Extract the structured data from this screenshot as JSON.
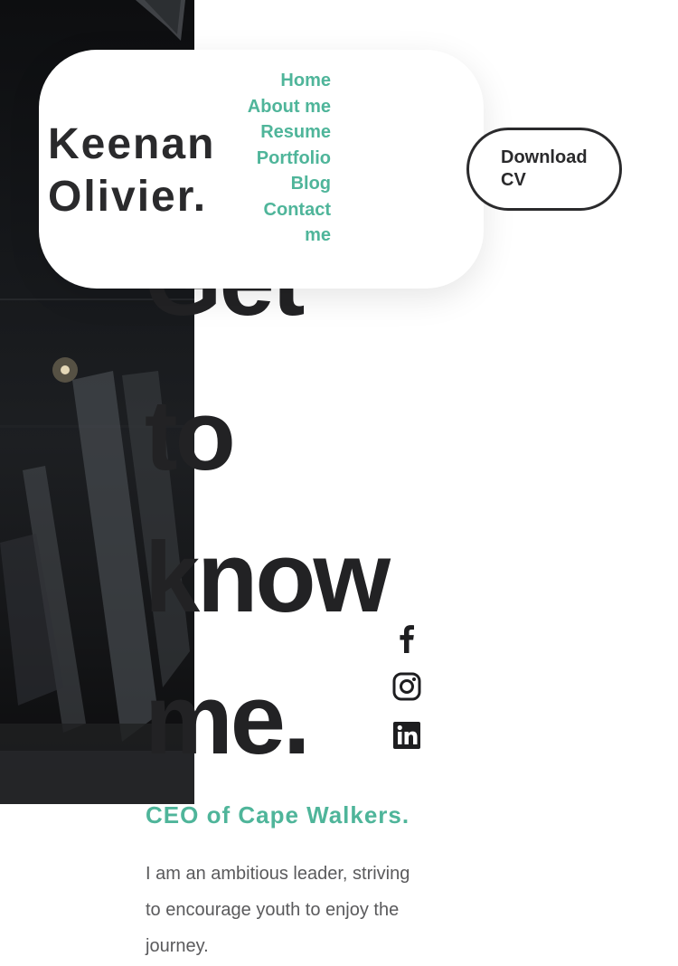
{
  "brand": {
    "line1": "Keenan",
    "line2": "Olivier."
  },
  "nav": {
    "items": [
      {
        "label": "Home"
      },
      {
        "label": "About me"
      },
      {
        "label": "Resume"
      },
      {
        "label": "Portfolio"
      },
      {
        "label": "Blog"
      },
      {
        "label": "Contact me"
      }
    ]
  },
  "header": {
    "cv_button_label": "Download CV"
  },
  "hero": {
    "heading_words": [
      "Get",
      "to",
      "know",
      "me."
    ],
    "subtitle": "CEO of Cape Walkers.",
    "description": "I am an ambitious leader, striving to encourage youth to enjoy the journey."
  },
  "social": {
    "icons": [
      "facebook-icon",
      "instagram-icon",
      "linkedin-icon"
    ]
  },
  "colors": {
    "accent": "#4fb59a",
    "text_dark": "#2a2a2c",
    "heading": "#222224",
    "body_text": "#5a5a5c",
    "photo_dark": "#15171a",
    "background": "#ffffff"
  }
}
